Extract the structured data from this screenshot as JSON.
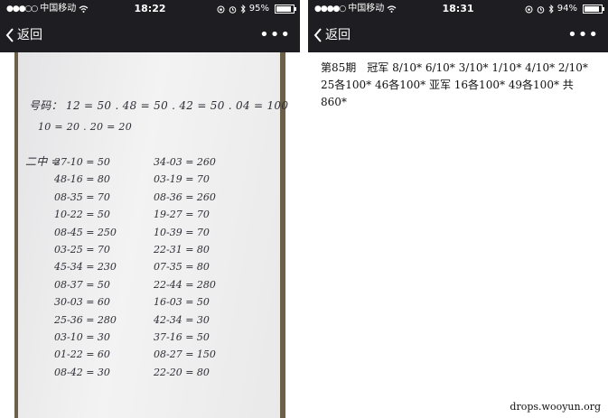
{
  "left": {
    "status": {
      "carrier": "中国移动",
      "time": "18:22",
      "battery": "95%",
      "battery_level": 0.95
    },
    "nav": {
      "back_label": "返回",
      "more_label": "•••"
    },
    "photo": {
      "header_line1": "号码： 12 = 50 . 48 = 50 . 42 = 50 . 04 = 100",
      "header_line2": "10 = 20 . 20 = 20",
      "sub_label": "二中 =",
      "left_column": [
        "27-10 = 50",
        "48-16 = 80",
        "08-35 = 70",
        "10-22 = 50",
        "08-45 = 250",
        "03-25 = 70",
        "45-34 = 230",
        "08-37 = 50",
        "30-03 = 60",
        "25-36 = 280",
        "03-10 = 30",
        "01-22 = 60",
        "08-42 = 30"
      ],
      "right_column": [
        "34-03 = 260",
        "03-19 = 70",
        "08-36 = 260",
        "19-27 = 70",
        "10-39 = 70",
        "22-31 = 80",
        "07-35 = 80",
        "22-44 = 280",
        "16-03 = 50",
        "42-34 = 30",
        "37-16 = 50",
        "08-27 = 150",
        "22-20 = 80"
      ]
    }
  },
  "right": {
    "status": {
      "carrier": "中国移动",
      "time": "18:31",
      "battery": "94%",
      "battery_level": 0.94
    },
    "nav": {
      "back_label": "返回",
      "more_label": "•••"
    },
    "message": "第85期　冠军 8/10* 6/10* 3/10* 1/10* 4/10* 2/10* 25各100* 46各100* 亚军 16各100* 49各100* 共860*"
  },
  "watermark": "drops.wooyun.org"
}
